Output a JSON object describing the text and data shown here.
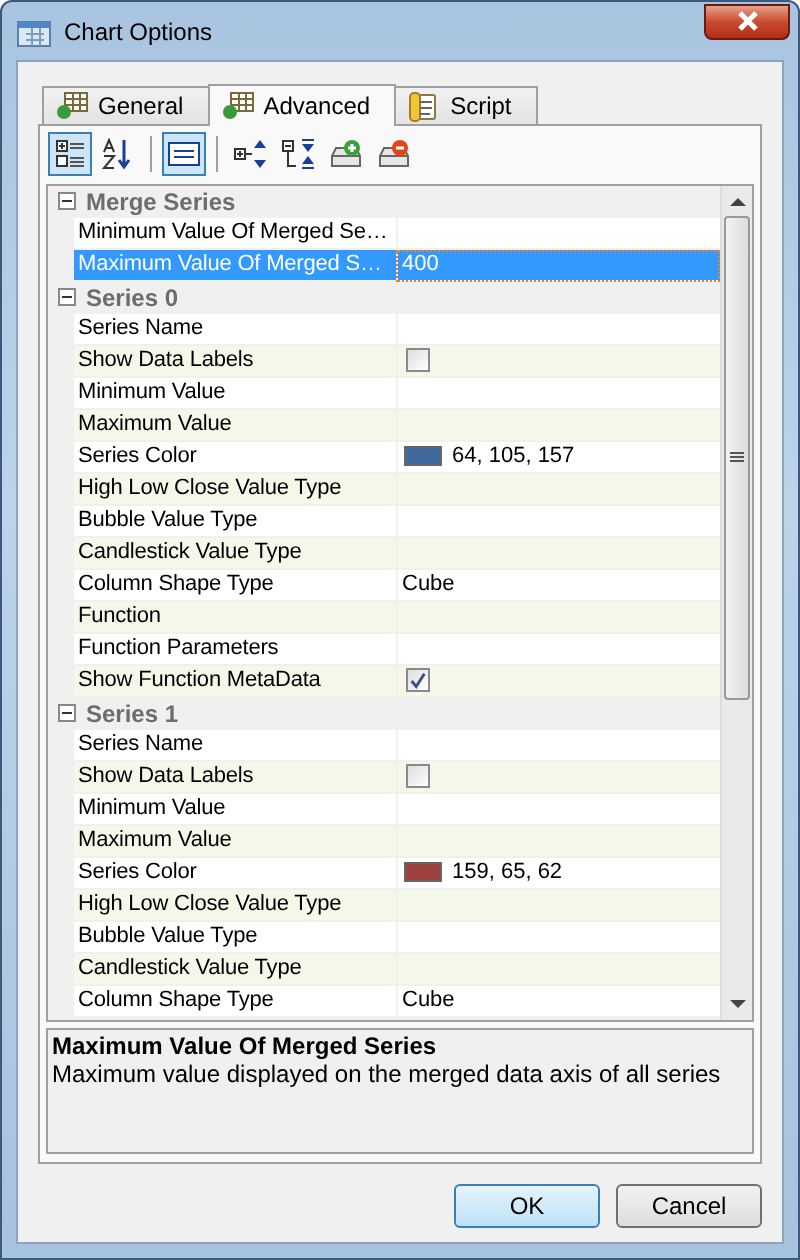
{
  "window": {
    "title": "Chart Options"
  },
  "tabs": [
    {
      "label": "General",
      "kind": "table",
      "selected": false
    },
    {
      "label": "Advanced",
      "kind": "table",
      "selected": true
    },
    {
      "label": "Script",
      "kind": "script",
      "selected": false
    }
  ],
  "toolbar": [
    {
      "kind": "categorized",
      "pressed": true
    },
    {
      "kind": "alphabetical",
      "pressed": false
    },
    {
      "kind": "separator"
    },
    {
      "kind": "pages",
      "pressed": true
    },
    {
      "kind": "separator"
    },
    {
      "kind": "expand",
      "pressed": false
    },
    {
      "kind": "collapse",
      "pressed": false
    },
    {
      "kind": "add",
      "pressed": false
    },
    {
      "kind": "remove",
      "pressed": false
    }
  ],
  "property_grid": [
    {
      "title": "Merge Series",
      "expanded": true,
      "properties": [
        {
          "name": "Minimum Value Of Merged Se…",
          "kind": "text",
          "selected": false
        },
        {
          "name": "Maximum Value Of Merged S…",
          "kind": "text",
          "value": "400",
          "selected": true
        }
      ]
    },
    {
      "title": "Series 0",
      "expanded": true,
      "properties": [
        {
          "name": "Series Name",
          "kind": "text",
          "selected": false
        },
        {
          "name": "Show Data Labels",
          "kind": "checkbox",
          "checked": false,
          "selected": false
        },
        {
          "name": "Minimum Value",
          "kind": "text",
          "selected": false
        },
        {
          "name": "Maximum Value",
          "kind": "text",
          "selected": false
        },
        {
          "name": "Series Color",
          "kind": "color",
          "color": "#40699d",
          "value": "64, 105, 157",
          "selected": false
        },
        {
          "name": "High Low Close Value Type",
          "kind": "text",
          "selected": false
        },
        {
          "name": "Bubble Value Type",
          "kind": "text",
          "selected": false
        },
        {
          "name": "Candlestick Value Type",
          "kind": "text",
          "selected": false
        },
        {
          "name": "Column Shape Type",
          "kind": "text",
          "value": "Cube",
          "selected": false
        },
        {
          "name": "Function",
          "kind": "text",
          "selected": false
        },
        {
          "name": "Function Parameters",
          "kind": "text",
          "selected": false
        },
        {
          "name": "Show Function MetaData",
          "kind": "checkbox",
          "checked": true,
          "selected": false
        }
      ]
    },
    {
      "title": "Series 1",
      "expanded": true,
      "properties": [
        {
          "name": "Series Name",
          "kind": "text",
          "selected": false
        },
        {
          "name": "Show Data Labels",
          "kind": "checkbox",
          "checked": false,
          "selected": false
        },
        {
          "name": "Minimum Value",
          "kind": "text",
          "selected": false
        },
        {
          "name": "Maximum Value",
          "kind": "text",
          "selected": false
        },
        {
          "name": "Series Color",
          "kind": "color",
          "color": "#9f413e",
          "value": "159, 65, 62",
          "selected": false
        },
        {
          "name": "High Low Close Value Type",
          "kind": "text",
          "selected": false
        },
        {
          "name": "Bubble Value Type",
          "kind": "text",
          "selected": false
        },
        {
          "name": "Candlestick Value Type",
          "kind": "text",
          "selected": false
        },
        {
          "name": "Column Shape Type",
          "kind": "text",
          "value": "Cube",
          "selected": false
        }
      ]
    }
  ],
  "description": {
    "title": "Maximum Value Of Merged Series",
    "text": "Maximum value displayed on the merged data axis of all series"
  },
  "buttons": [
    {
      "label": "OK",
      "default": true
    },
    {
      "label": "Cancel",
      "default": false
    }
  ]
}
